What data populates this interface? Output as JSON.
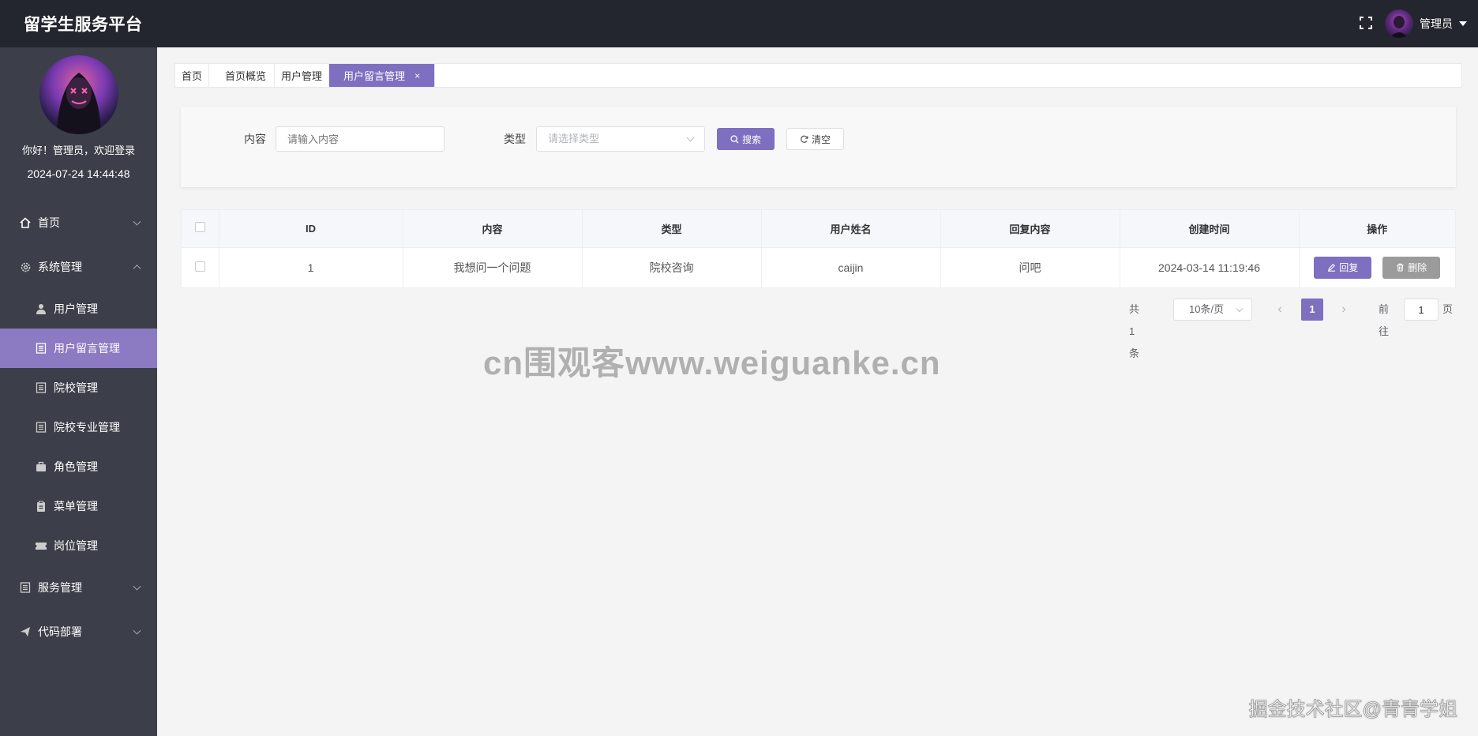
{
  "header": {
    "app_title": "留学生服务平台",
    "admin_name": "管理员"
  },
  "sidebar": {
    "welcome": "你好！管理员，欢迎登录",
    "login_time": "2024-07-24 14:44:48",
    "items": [
      {
        "label": "首页"
      },
      {
        "label": "系统管理"
      },
      {
        "label": "用户管理"
      },
      {
        "label": "用户留言管理"
      },
      {
        "label": "院校管理"
      },
      {
        "label": "院校专业管理"
      },
      {
        "label": "角色管理"
      },
      {
        "label": "菜单管理"
      },
      {
        "label": "岗位管理"
      },
      {
        "label": "服务管理"
      },
      {
        "label": "代码部署"
      }
    ]
  },
  "tabs": [
    {
      "label": "首页"
    },
    {
      "label": "首页概览"
    },
    {
      "label": "用户管理"
    },
    {
      "label": "用户留言管理",
      "close": "×"
    }
  ],
  "search": {
    "content_label": "内容",
    "content_placeholder": "请输入内容",
    "type_label": "类型",
    "type_placeholder": "请选择类型",
    "search_label": "搜索",
    "clear_label": "清空"
  },
  "table": {
    "columns": [
      "ID",
      "内容",
      "类型",
      "用户姓名",
      "回复内容",
      "创建时间",
      "操作"
    ],
    "rows": [
      {
        "id": "1",
        "content": "我想问一个问题",
        "type": "院校咨询",
        "user_name": "caijin",
        "reply": "问吧",
        "created": "2024-03-14 11:19:46",
        "reply_btn": "回复",
        "delete_btn": "删除"
      }
    ]
  },
  "pagination": {
    "total": "共 1 条",
    "page_size": "10条/页",
    "current_page": "1",
    "goto_label": "前往",
    "goto_value": "1",
    "page_unit": "页"
  },
  "watermarks": {
    "center": "cn围观客www.weiguanke.cn",
    "corner": "掘金技术社区@青青学姐"
  },
  "colors": {
    "accent": "#7e6fc0",
    "header_bg": "#23262e",
    "sidebar_bg": "#3c3f4a",
    "active_menu": "#8c7ac3"
  }
}
